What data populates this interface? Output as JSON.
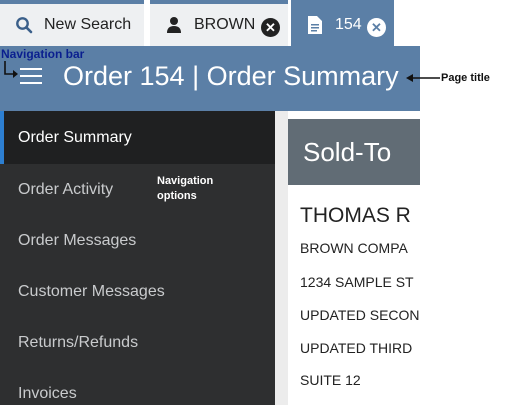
{
  "tabs": [
    {
      "label": "New Search",
      "icon": "search-icon"
    },
    {
      "label": "BROWN",
      "icon": "person-icon",
      "closable": true
    },
    {
      "label": "154",
      "icon": "document-icon",
      "closable": true,
      "active": true
    }
  ],
  "header": {
    "title": "Order 154 | Order Summary"
  },
  "sidebar": {
    "items": [
      {
        "label": "Order Summary",
        "active": true
      },
      {
        "label": "Order Activity"
      },
      {
        "label": "Order Messages"
      },
      {
        "label": "Customer Messages"
      },
      {
        "label": "Returns/Refunds"
      },
      {
        "label": "Invoices"
      }
    ]
  },
  "sold_to": {
    "heading": "Sold-To",
    "name": "THOMAS R",
    "lines": [
      "BROWN COMPA",
      "1234 SAMPLE ST",
      "UPDATED SECON",
      "UPDATED THIRD",
      "SUITE 12"
    ]
  },
  "annotations": {
    "navigation_bar": "Navigation bar",
    "navigation_options_line1": "Navigation",
    "navigation_options_line2": "options",
    "page_title": "Page title"
  },
  "colors": {
    "header": "#5b7fa6",
    "sidebar": "#2e2f30",
    "active_indicator": "#2d7fd1",
    "section_header": "#616c75"
  }
}
